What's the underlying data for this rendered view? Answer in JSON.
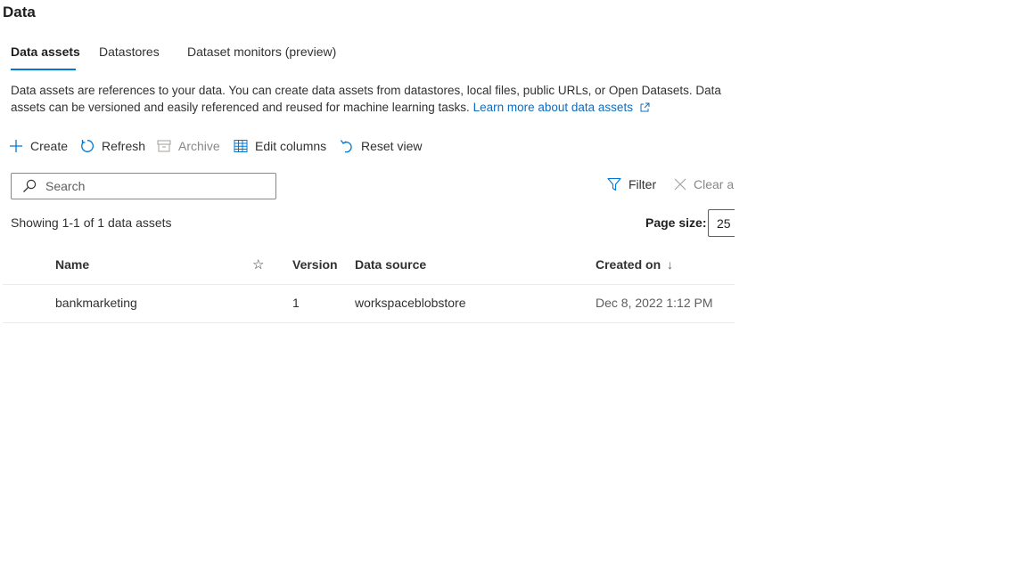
{
  "page": {
    "title": "Data"
  },
  "tabs": [
    {
      "label": "Data assets",
      "active": true
    },
    {
      "label": "Datastores",
      "active": false
    },
    {
      "label": "Dataset monitors (preview)",
      "active": false
    }
  ],
  "description": {
    "text": "Data assets are references to your data. You can create data assets from datastores, local files, public URLs, or Open Datasets. Data assets can be versioned and easily referenced and reused for machine learning tasks.",
    "link_label": "Learn more about data assets"
  },
  "toolbar": {
    "create_label": "Create",
    "refresh_label": "Refresh",
    "archive_label": "Archive",
    "edit_columns_label": "Edit columns",
    "reset_view_label": "Reset view"
  },
  "search": {
    "placeholder": "Search",
    "value": ""
  },
  "filters": {
    "filter_label": "Filter",
    "clear_label": "Clear all"
  },
  "summary": {
    "showing_text": "Showing 1-1 of 1 data assets"
  },
  "pagination": {
    "page_size_label": "Page size:",
    "page_size_value": "25"
  },
  "table": {
    "columns": {
      "name": "Name",
      "favorite": "☆",
      "version": "Version",
      "data_source": "Data source",
      "created_on": "Created on",
      "sort_indicator": "↓"
    },
    "rows": [
      {
        "name": "bankmarketing",
        "version": "1",
        "data_source": "workspaceblobstore",
        "created_on": "Dec 8, 2022 1:12 PM"
      }
    ]
  },
  "colors": {
    "accent": "#0078d4",
    "link": "#0f6cbd",
    "text": "#323130",
    "disabled": "#8a8886"
  }
}
